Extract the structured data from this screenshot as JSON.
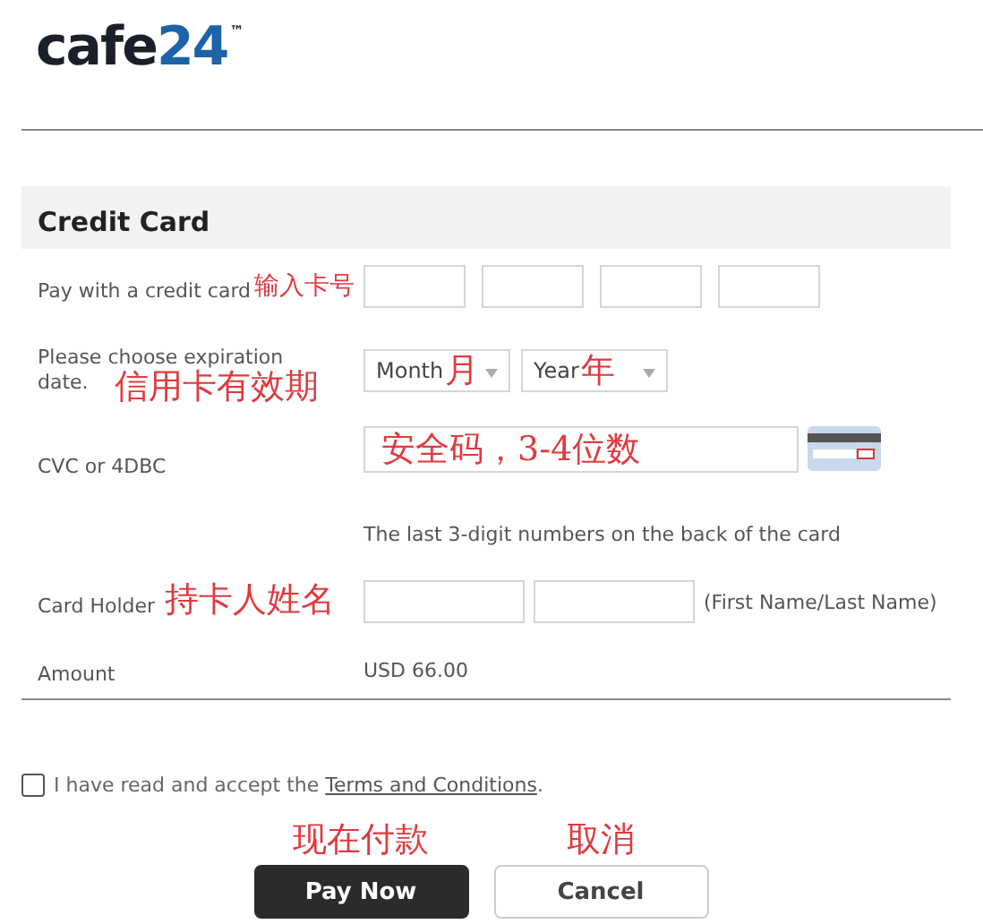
{
  "logo": {
    "word": "cafe",
    "number": "24",
    "mark": "™"
  },
  "section_title": "Credit Card",
  "rows": [
    {
      "kind": "card_number",
      "label": "Pay with a credit card",
      "annotation": "输入卡号"
    },
    {
      "kind": "expiry",
      "label_lines": [
        "Please choose expiration",
        "date."
      ],
      "annotation": "信用卡有效期",
      "selects": [
        {
          "label": "Month",
          "annotation": "月"
        },
        {
          "label": "Year",
          "annotation": "年"
        }
      ]
    },
    {
      "kind": "cvc",
      "label": "CVC or 4DBC",
      "annotation": "安全码，3-4位数",
      "hint": "The last 3-digit numbers on the back of the card"
    },
    {
      "kind": "holder",
      "label": "Card Holder",
      "annotation": "持卡人姓名",
      "note": "(First Name/Last Name)"
    },
    {
      "kind": "amount",
      "label": "Amount",
      "value": "USD 66.00"
    }
  ],
  "agreement": {
    "checked": false,
    "text": "I have read and accept the ",
    "link": "Terms and Conditions",
    "after": "."
  },
  "buttons": [
    {
      "kind": "primary",
      "label": "Pay Now",
      "annotation": "现在付款"
    },
    {
      "kind": "secondary",
      "label": "Cancel",
      "annotation": "取消"
    }
  ]
}
